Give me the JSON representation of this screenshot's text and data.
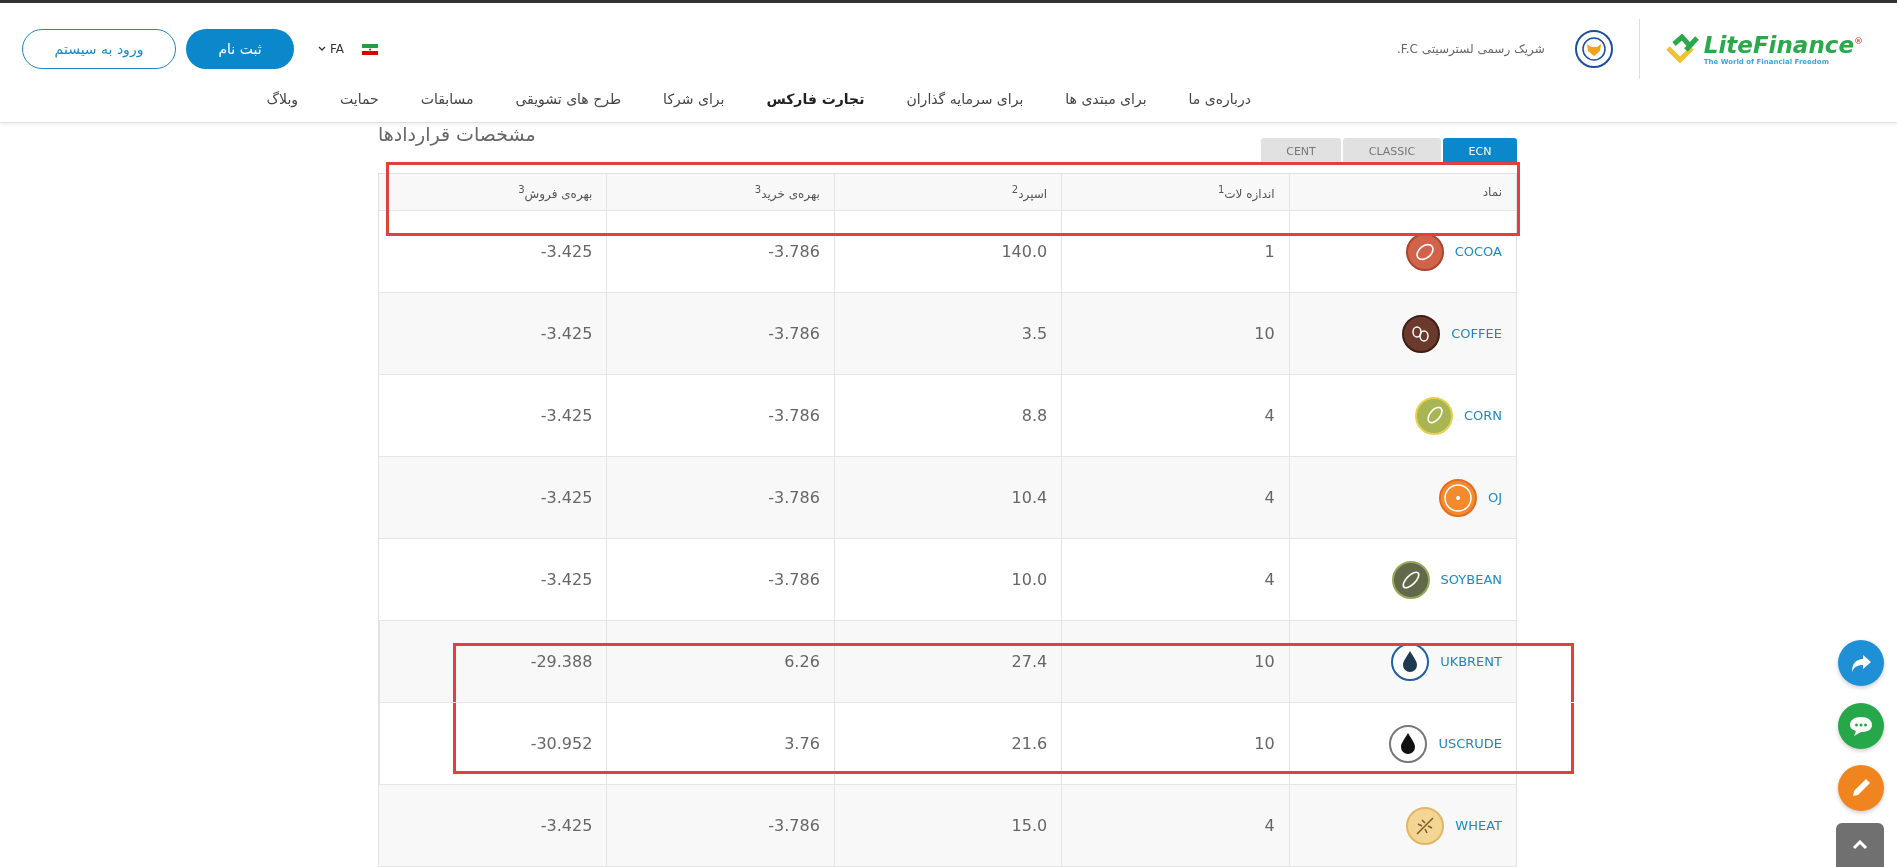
{
  "header": {
    "login_button": "ورود به سیستم",
    "register_button": "ثبت نام",
    "language": "FA",
    "partner_text": "شریک رسمی لسترسیتی F.C.",
    "logo": {
      "name": "LiteFinance",
      "mark": "®",
      "tagline": "The World of Financial Freedom"
    }
  },
  "nav": [
    {
      "label": "درباره‌ی ما",
      "selected": false
    },
    {
      "label": "برای مبتدی ها",
      "selected": false
    },
    {
      "label": "برای سرمایه گذاران",
      "selected": false
    },
    {
      "label": "تجارت فارکس",
      "selected": true
    },
    {
      "label": "برای شرکا",
      "selected": false
    },
    {
      "label": "طرح های تشویقی",
      "selected": false
    },
    {
      "label": "مسابقات",
      "selected": false
    },
    {
      "label": "حمایت",
      "selected": false
    },
    {
      "label": "وبلاگ",
      "selected": false
    }
  ],
  "title": "مشخصات قراردادها",
  "account_tabs": [
    {
      "label": "ECN",
      "selected": true
    },
    {
      "label": "CLASSIC",
      "selected": false
    },
    {
      "label": "CENT",
      "selected": false
    }
  ],
  "table": {
    "header_highlighted": true,
    "columns": [
      "نماد",
      "اندازه لات$^{1}$",
      "اسپرد$^{2}$",
      "بهره‌ی خرید$^{3}$",
      "بهره‌ی فروش$^{3}$"
    ],
    "rows": [
      {
        "kind": "cocoa",
        "symbol": "COCOA",
        "lot": "1",
        "spread": "140.0",
        "buy": "-3.786",
        "sell": "-3.425",
        "highlighted": false
      },
      {
        "kind": "coffee",
        "symbol": "COFFEE",
        "lot": "10",
        "spread": "3.5",
        "buy": "-3.786",
        "sell": "-3.425",
        "highlighted": false
      },
      {
        "kind": "corn",
        "symbol": "CORN",
        "lot": "4",
        "spread": "8.8",
        "buy": "-3.786",
        "sell": "-3.425",
        "highlighted": false
      },
      {
        "kind": "orange",
        "symbol": "OJ",
        "lot": "4",
        "spread": "10.4",
        "buy": "-3.786",
        "sell": "-3.425",
        "highlighted": false
      },
      {
        "kind": "soybean",
        "symbol": "SOYBEAN",
        "lot": "4",
        "spread": "10.0",
        "buy": "-3.786",
        "sell": "-3.425",
        "highlighted": false
      },
      {
        "kind": "brent",
        "symbol": "UKBRENT",
        "lot": "10",
        "spread": "27.4",
        "buy": "6.26",
        "sell": "-29.388",
        "highlighted": true
      },
      {
        "kind": "crude",
        "symbol": "USCRUDE",
        "lot": "10",
        "spread": "21.6",
        "buy": "3.76",
        "sell": "-30.952",
        "highlighted": true
      },
      {
        "kind": "wheat",
        "symbol": "WHEAT",
        "lot": "4",
        "spread": "15.0",
        "buy": "-3.786",
        "sell": "-3.425",
        "highlighted": false
      }
    ]
  }
}
